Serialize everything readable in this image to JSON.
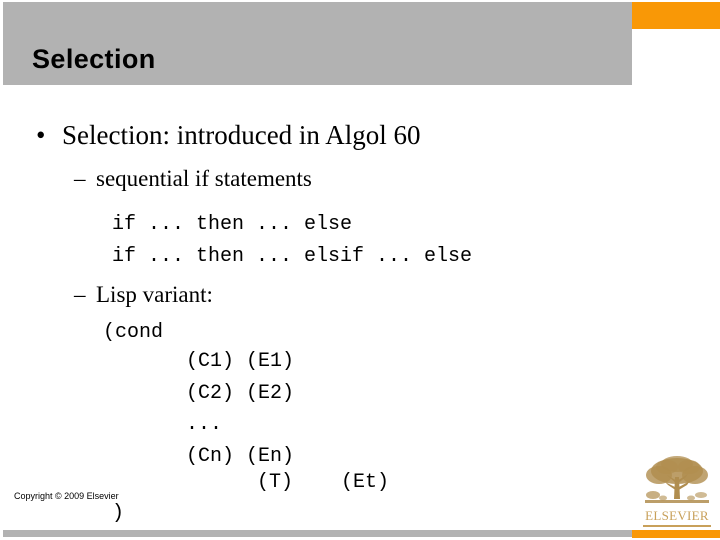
{
  "slide": {
    "title": "Selection",
    "colors": {
      "header_gray": "#b2b2b2",
      "accent_orange": "#f99806",
      "logo_gold": "#c8a05a",
      "text_black": "#000000"
    },
    "body": {
      "bullet_glyph": "•",
      "dash_glyph": "–",
      "level1": [
        {
          "text": "Selection: introduced in Algol 60"
        }
      ],
      "level2": [
        {
          "text": "sequential if statements"
        },
        {
          "text": "Lisp variant:"
        }
      ],
      "code_block_if": [
        "if ... then ... else",
        "if ... then ... elsif ... else"
      ],
      "code_block_cond": [
        "(cond",
        "(C1) (E1)",
        "(C2) (E2)",
        "...",
        "(Cn) (En)",
        "(T)    (Et)",
        ")"
      ]
    },
    "footer": {
      "copyright": "Copyright © 2009 Elsevier"
    },
    "logo": {
      "wordmark": "ELSEVIER",
      "alt": "elsevier-tree-logo"
    }
  }
}
